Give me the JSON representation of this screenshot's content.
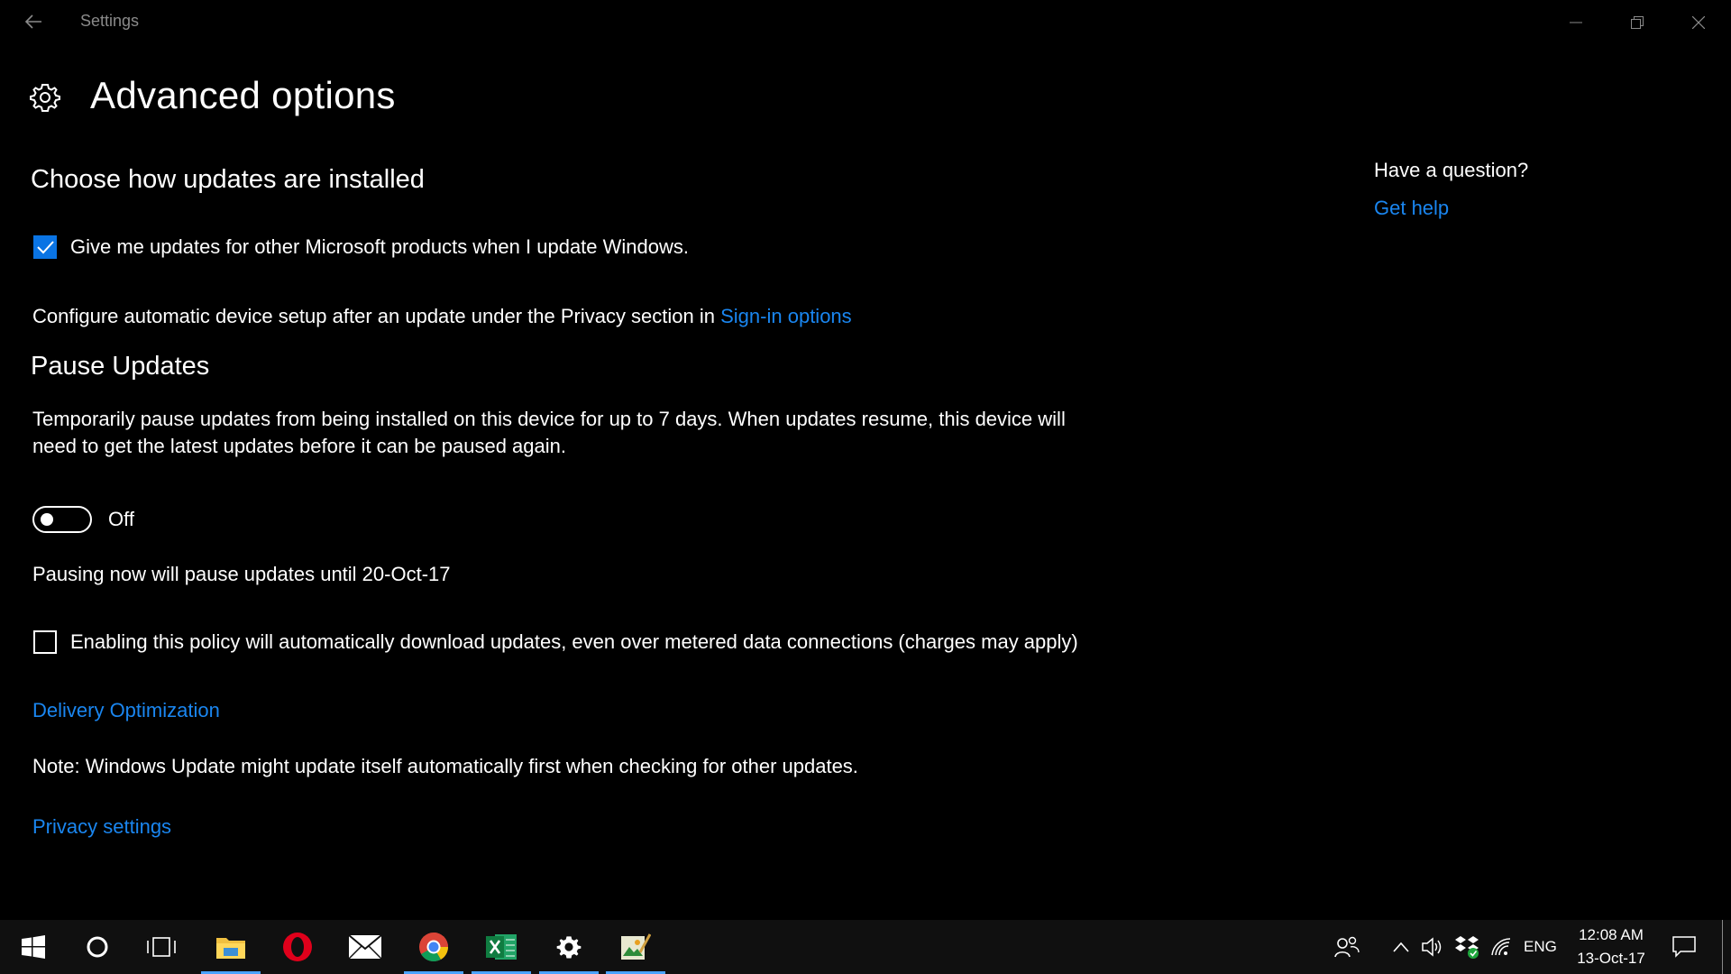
{
  "window": {
    "title": "Settings"
  },
  "page": {
    "title": "Advanced options"
  },
  "install_section": {
    "heading": "Choose how updates are installed",
    "checkbox_label": "Give me updates for other Microsoft products when I update Windows.",
    "checkbox_checked": true,
    "configure_text": "Configure automatic device setup after an update under the Privacy section in ",
    "configure_link": "Sign-in options"
  },
  "pause_section": {
    "heading": "Pause Updates",
    "description_line1": "Temporarily pause updates from being installed on this device for up to 7 days. When updates resume, this device will",
    "description_line2": "need to get the latest updates before it can be paused again.",
    "toggle_state": "Off",
    "pause_until_text": "Pausing now will pause updates until 20-Oct-17",
    "metered_label": "Enabling this policy will automatically download updates, even over metered data connections (charges may apply)",
    "metered_checked": false
  },
  "links": {
    "delivery_optimization": "Delivery Optimization",
    "privacy_settings": "Privacy settings"
  },
  "note": "Note: Windows Update might update itself automatically first when checking for other updates.",
  "help": {
    "question": "Have a question?",
    "link": "Get help"
  },
  "taskbar": {
    "tray_language": "ENG",
    "time": "12:08 AM",
    "date": "13-Oct-17"
  },
  "colors": {
    "accent": "#1a86f0",
    "background": "#000000",
    "taskbar": "#101010"
  }
}
